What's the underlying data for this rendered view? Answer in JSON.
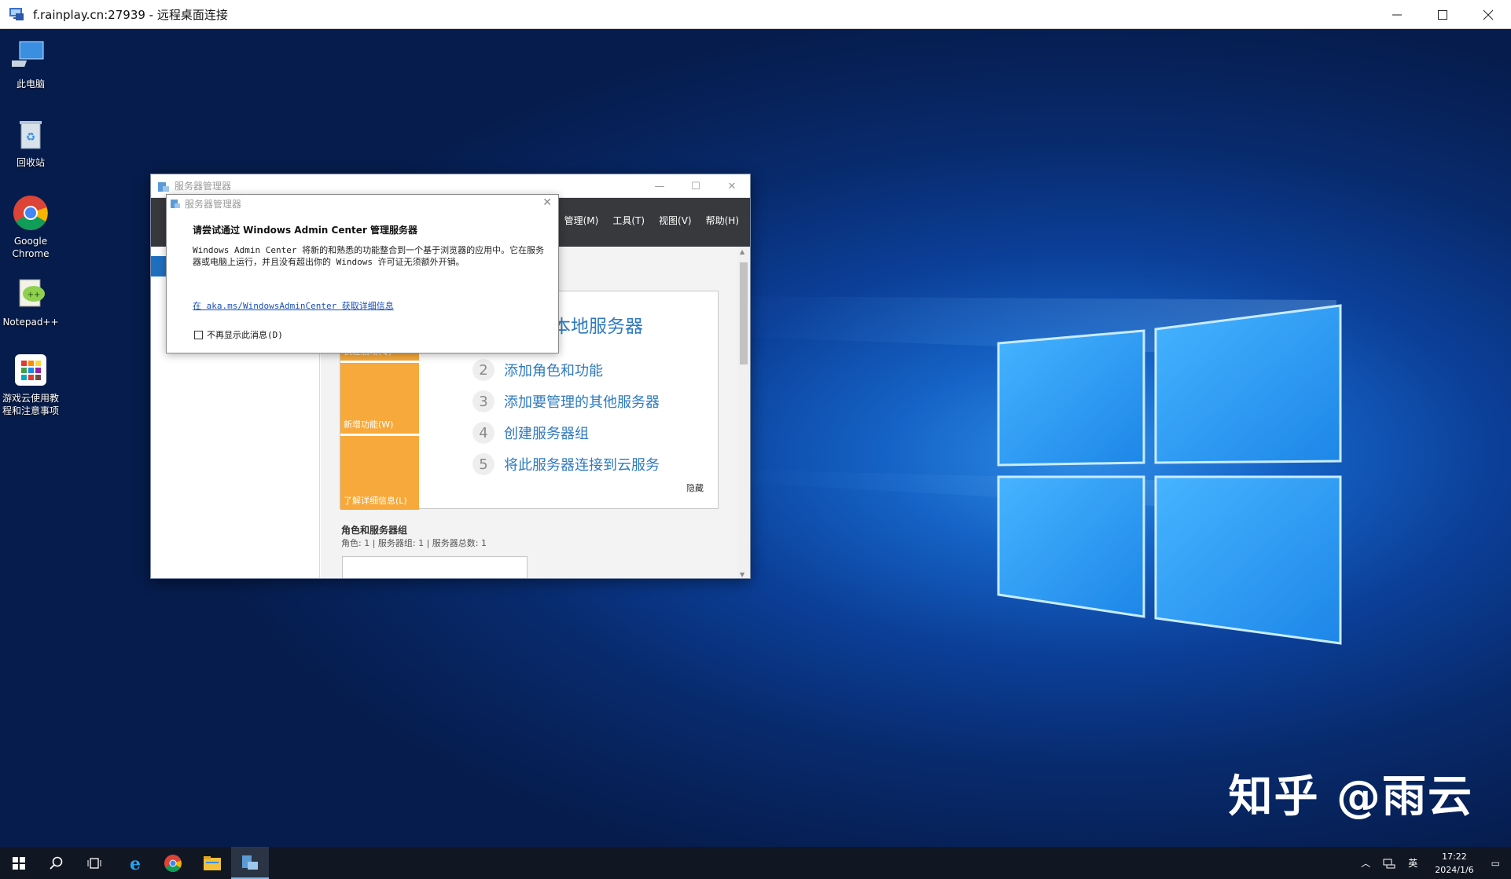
{
  "rdp_window": {
    "title": "f.rainplay.cn:27939 - 远程桌面连接",
    "minimize_glyph": "—",
    "maximize_glyph": "☐",
    "close_glyph": "✕"
  },
  "desktop": {
    "icons": [
      {
        "label": "此电脑",
        "icon": "computer-icon"
      },
      {
        "label": "回收站",
        "icon": "recycle-bin-icon"
      },
      {
        "label": "Google Chrome",
        "icon": "chrome-icon"
      },
      {
        "label": "Notepad++",
        "icon": "notepadpp-icon"
      },
      {
        "label": "游戏云使用教程和注意事项",
        "icon": "app-shortcut-icon"
      }
    ],
    "watermark": "知乎 @雨云"
  },
  "server_manager": {
    "title": "服务器管理器",
    "menu": [
      "管理(M)",
      "工具(T)",
      "视图(V)",
      "帮助(H)"
    ],
    "quick_start": {
      "title": "本地服务器",
      "left_labels": [
        "快速启动(Q)",
        "新增功能(W)",
        "了解详细信息(L)"
      ],
      "steps": [
        {
          "num": "2",
          "text": "添加角色和功能"
        },
        {
          "num": "3",
          "text": "添加要管理的其他服务器"
        },
        {
          "num": "4",
          "text": "创建服务器组"
        },
        {
          "num": "5",
          "text": "将此服务器连接到云服务"
        }
      ],
      "hide": "隐藏"
    },
    "roles": {
      "title": "角色和服务器组",
      "subtitle": "角色: 1 | 服务器组: 1 | 服务器总数: 1"
    }
  },
  "popup": {
    "title": "服务器管理器",
    "heading": "请尝试通过 Windows Admin Center 管理服务器",
    "body": "Windows Admin Center 将新的和熟悉的功能整合到一个基于浏览器的应用中。它在服务器或电脑上运行，并且没有超出你的 Windows 许可证无须额外开销。",
    "link": "在 aka.ms/WindowsAdminCenter 获取详细信息",
    "checkbox_label": "不再显示此消息(D)",
    "close_glyph": "✕"
  },
  "taskbar": {
    "ime": "英",
    "time": "17:22",
    "date": "2024/1/6"
  },
  "colors": {
    "accent": "#1f6fc1",
    "orange": "#f7a93b",
    "link_blue": "#2f7ac0",
    "taskbar": "#101722"
  }
}
